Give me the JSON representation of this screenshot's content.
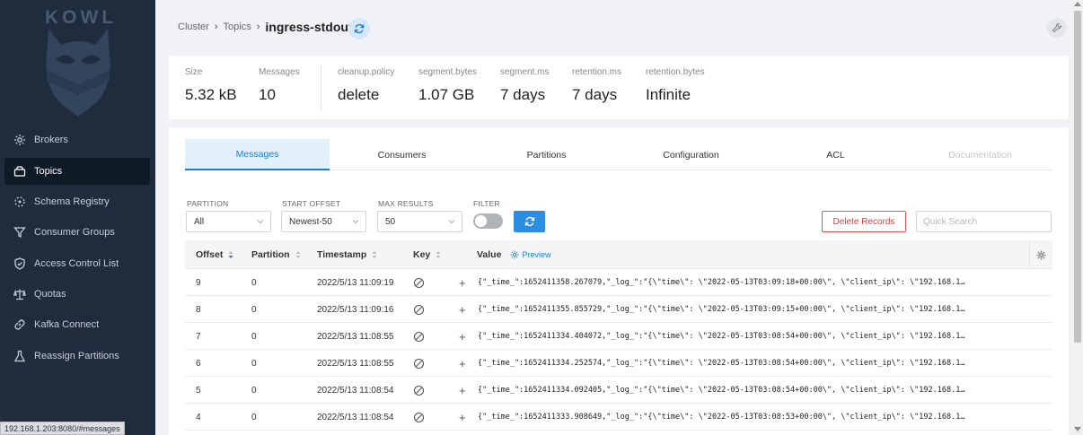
{
  "sidebar": {
    "logo_text": "KOWL",
    "items": [
      {
        "label": "Brokers",
        "icon": "cog-icon",
        "active": false
      },
      {
        "label": "Topics",
        "icon": "topics-icon",
        "active": true
      },
      {
        "label": "Schema Registry",
        "icon": "schema-icon",
        "active": false
      },
      {
        "label": "Consumer Groups",
        "icon": "funnel-icon",
        "active": false
      },
      {
        "label": "Access Control List",
        "icon": "shield-icon",
        "active": false
      },
      {
        "label": "Quotas",
        "icon": "scale-icon",
        "active": false
      },
      {
        "label": "Kafka Connect",
        "icon": "link-icon",
        "active": false
      },
      {
        "label": "Reassign Partitions",
        "icon": "beaker-icon",
        "active": false
      }
    ],
    "status_url": "192.168.1.203:8080/#messages"
  },
  "breadcrumb": {
    "cluster": "Cluster",
    "topics": "Topics",
    "current": "ingress-stdout"
  },
  "stats": [
    {
      "label": "Size",
      "value": "5.32 kB"
    },
    {
      "label": "Messages",
      "value": "10"
    },
    {
      "label": "cleanup.policy",
      "value": "delete"
    },
    {
      "label": "segment.bytes",
      "value": "1.07 GB"
    },
    {
      "label": "segment.ms",
      "value": "7 days"
    },
    {
      "label": "retention.ms",
      "value": "7 days"
    },
    {
      "label": "retention.bytes",
      "value": "Infinite"
    }
  ],
  "tabs": [
    {
      "label": "Messages",
      "state": "active"
    },
    {
      "label": "Consumers",
      "state": "normal"
    },
    {
      "label": "Partitions",
      "state": "normal"
    },
    {
      "label": "Configuration",
      "state": "normal"
    },
    {
      "label": "ACL",
      "state": "normal"
    },
    {
      "label": "Documentation",
      "state": "disabled"
    }
  ],
  "filters": {
    "partition_label": "PARTITION",
    "partition_value": "All",
    "start_offset_label": "START OFFSET",
    "start_offset_value": "Newest-50",
    "max_results_label": "MAX RESULTS",
    "max_results_value": "50",
    "filter_label": "FILTER",
    "delete_label": "Delete Records",
    "search_placeholder": "Quick Search"
  },
  "table": {
    "columns": {
      "offset": "Offset",
      "partition": "Partition",
      "timestamp": "Timestamp",
      "key": "Key",
      "value": "Value",
      "preview": "Preview"
    },
    "rows": [
      {
        "offset": "9",
        "partition": "0",
        "timestamp": "2022/5/13 11:09:19",
        "value": "{\"_time_\":1652411358.267079,\"_log_\":\"{\\\"time\\\": \\\"2022-05-13T03:09:18+00:00\\\", \\\"client_ip\\\": \\\"192.168.1…"
      },
      {
        "offset": "8",
        "partition": "0",
        "timestamp": "2022/5/13 11:09:16",
        "value": "{\"_time_\":1652411355.855729,\"_log_\":\"{\\\"time\\\": \\\"2022-05-13T03:09:15+00:00\\\", \\\"client_ip\\\": \\\"192.168.1…"
      },
      {
        "offset": "7",
        "partition": "0",
        "timestamp": "2022/5/13 11:08:55",
        "value": "{\"_time_\":1652411334.404072,\"_log_\":\"{\\\"time\\\": \\\"2022-05-13T03:08:54+00:00\\\", \\\"client_ip\\\": \\\"192.168.1…"
      },
      {
        "offset": "6",
        "partition": "0",
        "timestamp": "2022/5/13 11:08:55",
        "value": "{\"_time_\":1652411334.252574,\"_log_\":\"{\\\"time\\\": \\\"2022-05-13T03:08:54+00:00\\\", \\\"client_ip\\\": \\\"192.168.1…"
      },
      {
        "offset": "5",
        "partition": "0",
        "timestamp": "2022/5/13 11:08:54",
        "value": "{\"_time_\":1652411334.092405,\"_log_\":\"{\\\"time\\\": \\\"2022-05-13T03:08:54+00:00\\\", \\\"client_ip\\\": \\\"192.168.1…"
      },
      {
        "offset": "4",
        "partition": "0",
        "timestamp": "2022/5/13 11:08:54",
        "value": "{\"_time_\":1652411333.908649,\"_log_\":\"{\\\"time\\\": \\\"2022-05-13T03:08:53+00:00\\\", \\\"client_ip\\\": \\\"192.168.1…"
      }
    ]
  },
  "colors": {
    "sidebar_bg": "#1e2c3e",
    "accent": "#1c7ed6",
    "danger": "#e03c3c"
  }
}
